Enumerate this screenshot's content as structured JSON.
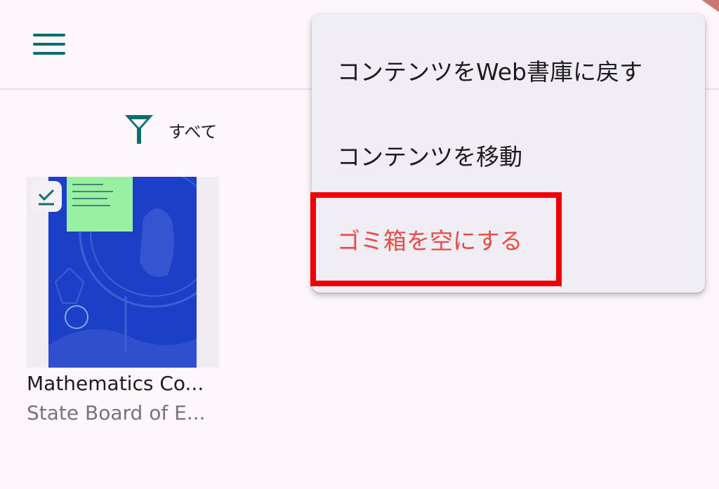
{
  "app_bar": {
    "menu_icon": "hamburger-menu-icon"
  },
  "filter": {
    "icon": "filter-icon",
    "label": "すべて"
  },
  "book": {
    "title": "Mathematics Co...",
    "author": "State Board of E...",
    "badge_icon": "download-check-icon"
  },
  "context_menu": {
    "items": [
      {
        "label": "コンテンツをWeb書庫に戻す"
      },
      {
        "label": "コンテンツを移動"
      },
      {
        "label": "ゴミ箱を空にする"
      }
    ]
  },
  "colors": {
    "primary": "#0d6e6e",
    "danger_text": "#e84b45",
    "highlight": "#ee0000",
    "cover_blue": "#1c3fc7",
    "cover_green": "#98f0a3"
  }
}
